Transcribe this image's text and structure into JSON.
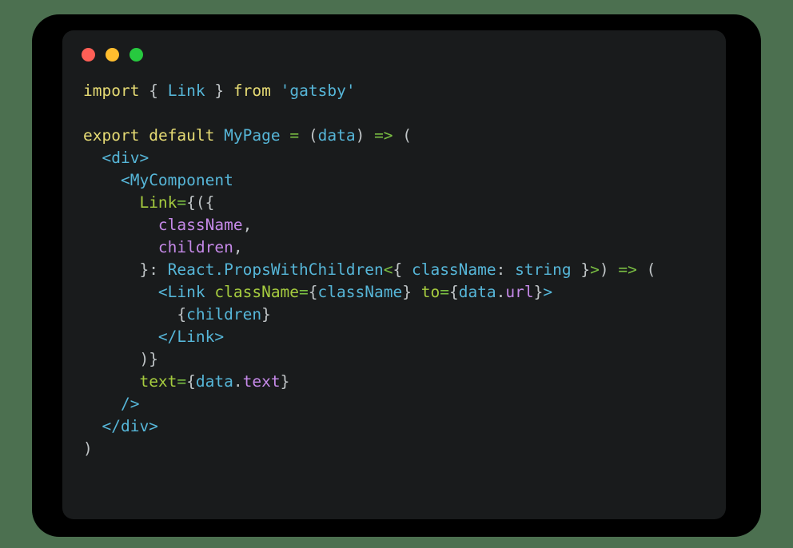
{
  "window": {
    "background_color": "#4c7050",
    "frame_color": "#000000",
    "panel_color": "#191b1c",
    "traffic_lights": [
      {
        "name": "close",
        "color": "#ff5f56"
      },
      {
        "name": "minimize",
        "color": "#ffbd2e"
      },
      {
        "name": "maximize",
        "color": "#27c93f"
      }
    ]
  },
  "editor": {
    "language": "tsx",
    "font_size": "19.5px",
    "line_height": "28px",
    "palette": {
      "keyword": "#e6db74",
      "string": "#56b6d8",
      "identifier": "#56b6d8",
      "punctuation": "#bfc4c6",
      "operator": "#7bc043",
      "attribute": "#a6cc3f",
      "property": "#c589e8",
      "foreground": "#c5c8c6",
      "background": "#191b1c"
    },
    "lines": [
      {
        "number": 1,
        "text": "import { Link } from 'gatsby'",
        "tokens": [
          {
            "t": "import",
            "c": "t-kw"
          },
          {
            "t": " ",
            "c": "t-plain"
          },
          {
            "t": "{",
            "c": "t-punct"
          },
          {
            "t": " ",
            "c": "t-plain"
          },
          {
            "t": "Link",
            "c": "t-ident"
          },
          {
            "t": " ",
            "c": "t-plain"
          },
          {
            "t": "}",
            "c": "t-punct"
          },
          {
            "t": " ",
            "c": "t-plain"
          },
          {
            "t": "from",
            "c": "t-kw"
          },
          {
            "t": " ",
            "c": "t-plain"
          },
          {
            "t": "'gatsby'",
            "c": "t-str"
          }
        ]
      },
      {
        "number": 2,
        "text": "",
        "tokens": []
      },
      {
        "number": 3,
        "text": "export default MyPage = (data) => (",
        "tokens": [
          {
            "t": "export",
            "c": "t-kw"
          },
          {
            "t": " ",
            "c": "t-plain"
          },
          {
            "t": "default",
            "c": "t-kw"
          },
          {
            "t": " ",
            "c": "t-plain"
          },
          {
            "t": "MyPage",
            "c": "t-ident"
          },
          {
            "t": " ",
            "c": "t-plain"
          },
          {
            "t": "=",
            "c": "t-op"
          },
          {
            "t": " ",
            "c": "t-plain"
          },
          {
            "t": "(",
            "c": "t-punct"
          },
          {
            "t": "data",
            "c": "t-ident"
          },
          {
            "t": ")",
            "c": "t-punct"
          },
          {
            "t": " ",
            "c": "t-plain"
          },
          {
            "t": "=>",
            "c": "t-op"
          },
          {
            "t": " ",
            "c": "t-plain"
          },
          {
            "t": "(",
            "c": "t-punct"
          }
        ]
      },
      {
        "number": 4,
        "text": "  <div>",
        "tokens": [
          {
            "t": "  ",
            "c": "t-plain"
          },
          {
            "t": "<div>",
            "c": "t-tag"
          }
        ]
      },
      {
        "number": 5,
        "text": "    <MyComponent",
        "tokens": [
          {
            "t": "    ",
            "c": "t-plain"
          },
          {
            "t": "<MyComponent",
            "c": "t-tag"
          }
        ]
      },
      {
        "number": 6,
        "text": "      Link={({",
        "tokens": [
          {
            "t": "      ",
            "c": "t-plain"
          },
          {
            "t": "Link",
            "c": "t-attr"
          },
          {
            "t": "=",
            "c": "t-op"
          },
          {
            "t": "{({",
            "c": "t-punct"
          }
        ]
      },
      {
        "number": 7,
        "text": "        className,",
        "tokens": [
          {
            "t": "        ",
            "c": "t-plain"
          },
          {
            "t": "className",
            "c": "t-prop"
          },
          {
            "t": ",",
            "c": "t-punct"
          }
        ]
      },
      {
        "number": 8,
        "text": "        children,",
        "tokens": [
          {
            "t": "        ",
            "c": "t-plain"
          },
          {
            "t": "children",
            "c": "t-prop"
          },
          {
            "t": ",",
            "c": "t-punct"
          }
        ]
      },
      {
        "number": 9,
        "text": "      }: React.PropsWithChildren<{ className: string }>) => (",
        "tokens": [
          {
            "t": "      ",
            "c": "t-plain"
          },
          {
            "t": "}:",
            "c": "t-punct"
          },
          {
            "t": " ",
            "c": "t-plain"
          },
          {
            "t": "React.PropsWithChildren",
            "c": "t-ident"
          },
          {
            "t": "<",
            "c": "t-op"
          },
          {
            "t": "{",
            "c": "t-punct"
          },
          {
            "t": " ",
            "c": "t-plain"
          },
          {
            "t": "className",
            "c": "t-ident"
          },
          {
            "t": ":",
            "c": "t-punct"
          },
          {
            "t": " ",
            "c": "t-plain"
          },
          {
            "t": "string",
            "c": "t-ident"
          },
          {
            "t": " ",
            "c": "t-plain"
          },
          {
            "t": "}",
            "c": "t-punct"
          },
          {
            "t": ">",
            "c": "t-op"
          },
          {
            "t": ")",
            "c": "t-punct"
          },
          {
            "t": " ",
            "c": "t-plain"
          },
          {
            "t": "=>",
            "c": "t-op"
          },
          {
            "t": " ",
            "c": "t-plain"
          },
          {
            "t": "(",
            "c": "t-punct"
          }
        ]
      },
      {
        "number": 10,
        "text": "        <Link className={className} to={data.url}>",
        "tokens": [
          {
            "t": "        ",
            "c": "t-plain"
          },
          {
            "t": "<Link",
            "c": "t-tag"
          },
          {
            "t": " ",
            "c": "t-plain"
          },
          {
            "t": "className",
            "c": "t-attr"
          },
          {
            "t": "=",
            "c": "t-op"
          },
          {
            "t": "{",
            "c": "t-punct"
          },
          {
            "t": "className",
            "c": "t-ident"
          },
          {
            "t": "}",
            "c": "t-punct"
          },
          {
            "t": " ",
            "c": "t-plain"
          },
          {
            "t": "to",
            "c": "t-attr"
          },
          {
            "t": "=",
            "c": "t-op"
          },
          {
            "t": "{",
            "c": "t-punct"
          },
          {
            "t": "data",
            "c": "t-ident"
          },
          {
            "t": ".",
            "c": "t-punct"
          },
          {
            "t": "url",
            "c": "t-prop"
          },
          {
            "t": "}",
            "c": "t-punct"
          },
          {
            "t": ">",
            "c": "t-tag"
          }
        ]
      },
      {
        "number": 11,
        "text": "          {children}",
        "tokens": [
          {
            "t": "          ",
            "c": "t-plain"
          },
          {
            "t": "{",
            "c": "t-punct"
          },
          {
            "t": "children",
            "c": "t-ident"
          },
          {
            "t": "}",
            "c": "t-punct"
          }
        ]
      },
      {
        "number": 12,
        "text": "        </Link>",
        "tokens": [
          {
            "t": "        ",
            "c": "t-plain"
          },
          {
            "t": "</Link>",
            "c": "t-tag"
          }
        ]
      },
      {
        "number": 13,
        "text": "      )}",
        "tokens": [
          {
            "t": "      ",
            "c": "t-plain"
          },
          {
            "t": ")}",
            "c": "t-punct"
          }
        ]
      },
      {
        "number": 14,
        "text": "      text={data.text}",
        "tokens": [
          {
            "t": "      ",
            "c": "t-plain"
          },
          {
            "t": "text",
            "c": "t-attr"
          },
          {
            "t": "=",
            "c": "t-op"
          },
          {
            "t": "{",
            "c": "t-punct"
          },
          {
            "t": "data",
            "c": "t-ident"
          },
          {
            "t": ".",
            "c": "t-punct"
          },
          {
            "t": "text",
            "c": "t-prop"
          },
          {
            "t": "}",
            "c": "t-punct"
          }
        ]
      },
      {
        "number": 15,
        "text": "    />",
        "tokens": [
          {
            "t": "    ",
            "c": "t-plain"
          },
          {
            "t": "/>",
            "c": "t-tag"
          }
        ]
      },
      {
        "number": 16,
        "text": "  </div>",
        "tokens": [
          {
            "t": "  ",
            "c": "t-plain"
          },
          {
            "t": "</div>",
            "c": "t-tag"
          }
        ]
      },
      {
        "number": 17,
        "text": ")",
        "tokens": [
          {
            "t": ")",
            "c": "t-punct"
          }
        ]
      }
    ]
  }
}
